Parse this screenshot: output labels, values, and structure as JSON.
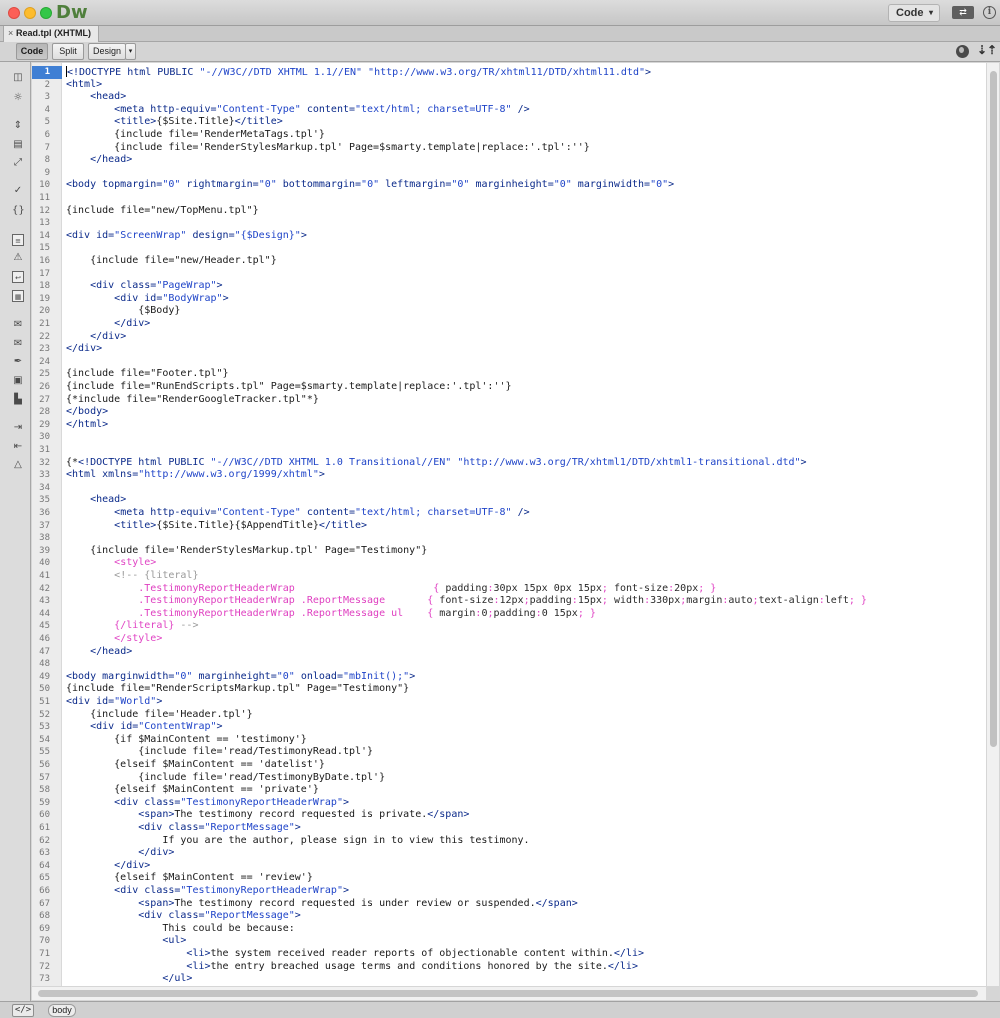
{
  "app": {
    "logo": "Dw",
    "workspace": "Code",
    "workspace_caret": "▾",
    "sync_glyph": "⇄",
    "info_glyph": "i"
  },
  "document": {
    "tab_label": "Read.tpl (XHTML)",
    "close_glyph": "×"
  },
  "toolbar": {
    "code_label": "Code",
    "split_label": "Split",
    "design_label": "Design",
    "design_caret": "▾",
    "sort_glyph": "⇣⇡"
  },
  "left_toolbar": {
    "icons": [
      "document-icon",
      "sun-icon",
      "expand-icon",
      "select-block-icon",
      "collapse-icon",
      "select-parent-icon",
      "braces-icon",
      "line-numbers-icon",
      "highlight-invalid-icon",
      "word-wrap-icon",
      "syntax-color-icon",
      "comment-icon",
      "uncomment-icon",
      "wrap-tag-icon",
      "recent-snippets-icon",
      "move-css-icon",
      "indent-icon",
      "outdent-icon",
      "format-source-icon"
    ]
  },
  "editor": {
    "current_line": 1,
    "lines": [
      [
        [
          "t-tag",
          "<!DOCTYPE html PUBLIC "
        ],
        [
          "t-val",
          "\"-//W3C//DTD XHTML 1.1//EN\""
        ],
        [
          "t-tag",
          " "
        ],
        [
          "t-val",
          "\"http://www.w3.org/TR/xhtml11/DTD/xhtml11.dtd\""
        ],
        [
          "t-tag",
          ">"
        ]
      ],
      [
        [
          "t-tag",
          "<html>"
        ]
      ],
      [
        [
          "t-text",
          "    "
        ],
        [
          "t-tag",
          "<head>"
        ]
      ],
      [
        [
          "t-text",
          "        "
        ],
        [
          "t-tag",
          "<meta "
        ],
        [
          "t-attr",
          "http-equiv="
        ],
        [
          "t-val",
          "\"Content-Type\""
        ],
        [
          "t-attr",
          " content="
        ],
        [
          "t-val",
          "\"text/html; charset=UTF-8\""
        ],
        [
          "t-tag",
          " />"
        ]
      ],
      [
        [
          "t-text",
          "        "
        ],
        [
          "t-tag",
          "<title>"
        ],
        [
          "t-text",
          "{$Site.Title}"
        ],
        [
          "t-tag",
          "</title>"
        ]
      ],
      [
        [
          "t-text",
          "        {include file='RenderMetaTags.tpl'}"
        ]
      ],
      [
        [
          "t-text",
          "        {include file='RenderStylesMarkup.tpl' Page=$smarty.template|replace:'.tpl':''}"
        ]
      ],
      [
        [
          "t-text",
          "    "
        ],
        [
          "t-tag",
          "</head>"
        ]
      ],
      [
        [
          "t-text",
          ""
        ]
      ],
      [
        [
          "t-tag",
          "<body "
        ],
        [
          "t-attr",
          "topmargin="
        ],
        [
          "t-val",
          "\"0\""
        ],
        [
          "t-attr",
          " rightmargin="
        ],
        [
          "t-val",
          "\"0\""
        ],
        [
          "t-attr",
          " bottommargin="
        ],
        [
          "t-val",
          "\"0\""
        ],
        [
          "t-attr",
          " leftmargin="
        ],
        [
          "t-val",
          "\"0\""
        ],
        [
          "t-attr",
          " marginheight="
        ],
        [
          "t-val",
          "\"0\""
        ],
        [
          "t-attr",
          " marginwidth="
        ],
        [
          "t-val",
          "\"0\""
        ],
        [
          "t-tag",
          ">"
        ]
      ],
      [
        [
          "t-text",
          ""
        ]
      ],
      [
        [
          "t-text",
          "{include file=\"new/TopMenu.tpl\"}"
        ]
      ],
      [
        [
          "t-text",
          ""
        ]
      ],
      [
        [
          "t-tag",
          "<div "
        ],
        [
          "t-attr",
          "id="
        ],
        [
          "t-val",
          "\"ScreenWrap\""
        ],
        [
          "t-attr",
          " design="
        ],
        [
          "t-val",
          "\"{$Design}\""
        ],
        [
          "t-tag",
          ">"
        ]
      ],
      [
        [
          "t-text",
          ""
        ]
      ],
      [
        [
          "t-text",
          "    {include file=\"new/Header.tpl\"}"
        ]
      ],
      [
        [
          "t-text",
          ""
        ]
      ],
      [
        [
          "t-text",
          "    "
        ],
        [
          "t-tag",
          "<div "
        ],
        [
          "t-attr",
          "class="
        ],
        [
          "t-val",
          "\"PageWrap\""
        ],
        [
          "t-tag",
          ">"
        ]
      ],
      [
        [
          "t-text",
          "        "
        ],
        [
          "t-tag",
          "<div "
        ],
        [
          "t-attr",
          "id="
        ],
        [
          "t-val",
          "\"BodyWrap\""
        ],
        [
          "t-tag",
          ">"
        ]
      ],
      [
        [
          "t-text",
          "            {$Body}"
        ]
      ],
      [
        [
          "t-text",
          "        "
        ],
        [
          "t-tag",
          "</div>"
        ]
      ],
      [
        [
          "t-text",
          "    "
        ],
        [
          "t-tag",
          "</div>"
        ]
      ],
      [
        [
          "t-tag",
          "</div>"
        ]
      ],
      [
        [
          "t-text",
          ""
        ]
      ],
      [
        [
          "t-text",
          "{include file=\"Footer.tpl\"}"
        ]
      ],
      [
        [
          "t-text",
          "{include file=\"RunEndScripts.tpl\" Page=$smarty.template|replace:'.tpl':''}"
        ]
      ],
      [
        [
          "t-text",
          "{*include file=\"RenderGoogleTracker.tpl\"*}"
        ]
      ],
      [
        [
          "t-tag",
          "</body>"
        ]
      ],
      [
        [
          "t-tag",
          "</html>"
        ]
      ],
      [
        [
          "t-text",
          ""
        ]
      ],
      [
        [
          "t-text",
          ""
        ]
      ],
      [
        [
          "t-text",
          "{*"
        ],
        [
          "t-tag",
          "<!DOCTYPE html PUBLIC "
        ],
        [
          "t-val",
          "\"-//W3C//DTD XHTML 1.0 Transitional//EN\""
        ],
        [
          "t-tag",
          " "
        ],
        [
          "t-val",
          "\"http://www.w3.org/TR/xhtml1/DTD/xhtml1-transitional.dtd\""
        ],
        [
          "t-tag",
          ">"
        ]
      ],
      [
        [
          "t-tag",
          "<html "
        ],
        [
          "t-attr",
          "xmlns="
        ],
        [
          "t-val",
          "\"http://www.w3.org/1999/xhtml\""
        ],
        [
          "t-tag",
          ">"
        ]
      ],
      [
        [
          "t-text",
          ""
        ]
      ],
      [
        [
          "t-text",
          "    "
        ],
        [
          "t-tag",
          "<head>"
        ]
      ],
      [
        [
          "t-text",
          "        "
        ],
        [
          "t-tag",
          "<meta "
        ],
        [
          "t-attr",
          "http-equiv="
        ],
        [
          "t-val",
          "\"Content-Type\""
        ],
        [
          "t-attr",
          " content="
        ],
        [
          "t-val",
          "\"text/html; charset=UTF-8\""
        ],
        [
          "t-tag",
          " />"
        ]
      ],
      [
        [
          "t-text",
          "        "
        ],
        [
          "t-tag",
          "<title>"
        ],
        [
          "t-text",
          "{$Site.Title}{$AppendTitle}"
        ],
        [
          "t-tag",
          "</title>"
        ]
      ],
      [
        [
          "t-text",
          ""
        ]
      ],
      [
        [
          "t-text",
          "    {include file='RenderStylesMarkup.tpl' Page=\"Testimony\"}"
        ]
      ],
      [
        [
          "t-text",
          "        "
        ],
        [
          "t-css",
          "<style>"
        ]
      ],
      [
        [
          "t-text",
          "        "
        ],
        [
          "t-comment",
          "<!-- {literal}"
        ]
      ],
      [
        [
          "t-text",
          "            "
        ],
        [
          "t-sel",
          ".TestimonyReportHeaderWrap"
        ],
        [
          "t-text",
          "                       "
        ],
        [
          "t-css",
          "{ "
        ],
        [
          "t-prop",
          "padding"
        ],
        [
          "t-css",
          ":"
        ],
        [
          "t-pval",
          "30px 15px 0px 15px"
        ],
        [
          "t-css",
          "; "
        ],
        [
          "t-prop",
          "font-size"
        ],
        [
          "t-css",
          ":"
        ],
        [
          "t-pval",
          "20px"
        ],
        [
          "t-css",
          "; }"
        ]
      ],
      [
        [
          "t-text",
          "            "
        ],
        [
          "t-sel",
          ".TestimonyReportHeaderWrap .ReportMessage"
        ],
        [
          "t-text",
          "       "
        ],
        [
          "t-css",
          "{ "
        ],
        [
          "t-prop",
          "font-size"
        ],
        [
          "t-css",
          ":"
        ],
        [
          "t-pval",
          "12px"
        ],
        [
          "t-css",
          ";"
        ],
        [
          "t-prop",
          "padding"
        ],
        [
          "t-css",
          ":"
        ],
        [
          "t-pval",
          "15px"
        ],
        [
          "t-css",
          "; "
        ],
        [
          "t-prop",
          "width"
        ],
        [
          "t-css",
          ":"
        ],
        [
          "t-pval",
          "330px"
        ],
        [
          "t-css",
          ";"
        ],
        [
          "t-prop",
          "margin"
        ],
        [
          "t-css",
          ":"
        ],
        [
          "t-pval",
          "auto"
        ],
        [
          "t-css",
          ";"
        ],
        [
          "t-prop",
          "text-align"
        ],
        [
          "t-css",
          ":"
        ],
        [
          "t-pval",
          "left"
        ],
        [
          "t-css",
          "; }"
        ]
      ],
      [
        [
          "t-text",
          "            "
        ],
        [
          "t-sel",
          ".TestimonyReportHeaderWrap .ReportMessage ul"
        ],
        [
          "t-text",
          "    "
        ],
        [
          "t-css",
          "{ "
        ],
        [
          "t-prop",
          "margin"
        ],
        [
          "t-css",
          ":"
        ],
        [
          "t-pval",
          "0"
        ],
        [
          "t-css",
          ";"
        ],
        [
          "t-prop",
          "padding"
        ],
        [
          "t-css",
          ":"
        ],
        [
          "t-pval",
          "0 15px"
        ],
        [
          "t-css",
          "; }"
        ]
      ],
      [
        [
          "t-text",
          "        "
        ],
        [
          "t-css",
          "{/literal}"
        ],
        [
          "t-comment",
          " -->"
        ]
      ],
      [
        [
          "t-text",
          "        "
        ],
        [
          "t-css",
          "</style>"
        ]
      ],
      [
        [
          "t-text",
          "    "
        ],
        [
          "t-tag",
          "</head>"
        ]
      ],
      [
        [
          "t-text",
          ""
        ]
      ],
      [
        [
          "t-tag",
          "<body "
        ],
        [
          "t-attr",
          "marginwidth="
        ],
        [
          "t-val",
          "\"0\""
        ],
        [
          "t-attr",
          " marginheight="
        ],
        [
          "t-val",
          "\"0\""
        ],
        [
          "t-attr",
          " onload="
        ],
        [
          "t-val",
          "\"mbInit();\""
        ],
        [
          "t-tag",
          ">"
        ]
      ],
      [
        [
          "t-text",
          "{include file=\"RenderScriptsMarkup.tpl\" Page=\"Testimony\"}"
        ]
      ],
      [
        [
          "t-tag",
          "<div "
        ],
        [
          "t-attr",
          "id="
        ],
        [
          "t-val",
          "\"World\""
        ],
        [
          "t-tag",
          ">"
        ]
      ],
      [
        [
          "t-text",
          "    {include file='Header.tpl'}"
        ]
      ],
      [
        [
          "t-text",
          "    "
        ],
        [
          "t-tag",
          "<div "
        ],
        [
          "t-attr",
          "id="
        ],
        [
          "t-val",
          "\"ContentWrap\""
        ],
        [
          "t-tag",
          ">"
        ]
      ],
      [
        [
          "t-text",
          "        {if $MainContent == 'testimony'}"
        ]
      ],
      [
        [
          "t-text",
          "            {include file='read/TestimonyRead.tpl'}"
        ]
      ],
      [
        [
          "t-text",
          "        {elseif $MainContent == 'datelist'}"
        ]
      ],
      [
        [
          "t-text",
          "            {include file='read/TestimonyByDate.tpl'}"
        ]
      ],
      [
        [
          "t-text",
          "        {elseif $MainContent == 'private'}"
        ]
      ],
      [
        [
          "t-text",
          "        "
        ],
        [
          "t-tag",
          "<div "
        ],
        [
          "t-attr",
          "class="
        ],
        [
          "t-val",
          "\"TestimonyReportHeaderWrap\""
        ],
        [
          "t-tag",
          ">"
        ]
      ],
      [
        [
          "t-text",
          "            "
        ],
        [
          "t-tag",
          "<span>"
        ],
        [
          "t-text",
          "The testimony record requested is private."
        ],
        [
          "t-tag",
          "</span>"
        ]
      ],
      [
        [
          "t-text",
          "            "
        ],
        [
          "t-tag",
          "<div "
        ],
        [
          "t-attr",
          "class="
        ],
        [
          "t-val",
          "\"ReportMessage\""
        ],
        [
          "t-tag",
          ">"
        ]
      ],
      [
        [
          "t-text",
          "                If you are the author, please sign in to view this testimony."
        ]
      ],
      [
        [
          "t-text",
          "            "
        ],
        [
          "t-tag",
          "</div>"
        ]
      ],
      [
        [
          "t-text",
          "        "
        ],
        [
          "t-tag",
          "</div>"
        ]
      ],
      [
        [
          "t-text",
          "        {elseif $MainContent == 'review'}"
        ]
      ],
      [
        [
          "t-text",
          "        "
        ],
        [
          "t-tag",
          "<div "
        ],
        [
          "t-attr",
          "class="
        ],
        [
          "t-val",
          "\"TestimonyReportHeaderWrap\""
        ],
        [
          "t-tag",
          ">"
        ]
      ],
      [
        [
          "t-text",
          "            "
        ],
        [
          "t-tag",
          "<span>"
        ],
        [
          "t-text",
          "The testimony record requested is under review or suspended."
        ],
        [
          "t-tag",
          "</span>"
        ]
      ],
      [
        [
          "t-text",
          "            "
        ],
        [
          "t-tag",
          "<div "
        ],
        [
          "t-attr",
          "class="
        ],
        [
          "t-val",
          "\"ReportMessage\""
        ],
        [
          "t-tag",
          ">"
        ]
      ],
      [
        [
          "t-text",
          "                This could be because:"
        ]
      ],
      [
        [
          "t-text",
          "                "
        ],
        [
          "t-tag",
          "<ul>"
        ]
      ],
      [
        [
          "t-text",
          "                    "
        ],
        [
          "t-tag",
          "<li>"
        ],
        [
          "t-text",
          "the system received reader reports of objectionable content within."
        ],
        [
          "t-tag",
          "</li>"
        ]
      ],
      [
        [
          "t-text",
          "                    "
        ],
        [
          "t-tag",
          "<li>"
        ],
        [
          "t-text",
          "the entry breached usage terms and conditions honored by the site."
        ],
        [
          "t-tag",
          "</li>"
        ]
      ],
      [
        [
          "t-text",
          "                "
        ],
        [
          "t-tag",
          "</ul>"
        ]
      ]
    ]
  },
  "status": {
    "tag_button": "</>",
    "crumb": "body"
  }
}
